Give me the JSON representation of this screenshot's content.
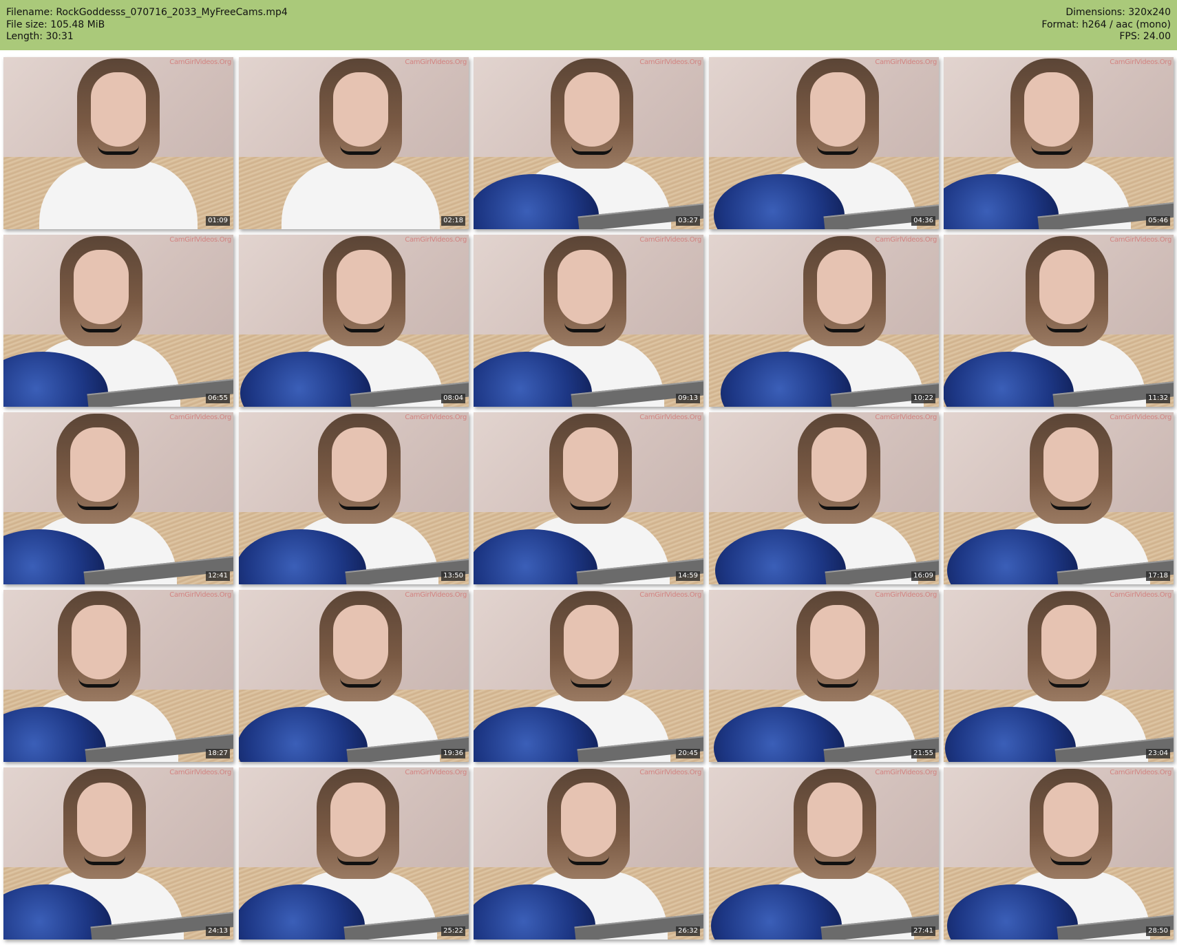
{
  "info": {
    "filename_label": "Filename:",
    "filename": "RockGoddesss_070716_2033_MyFreeCams.mp4",
    "filesize_label": "File size:",
    "filesize": "105.48 MiB",
    "length_label": "Length:",
    "length": "30:31",
    "dimensions_label": "Dimensions:",
    "dimensions": "320x240",
    "format_label": "Format:",
    "format": "h264 / aac (mono)",
    "fps_label": "FPS:",
    "fps": "24.00"
  },
  "watermark": "CamGirlVideos.Org",
  "thumbnails": [
    {
      "timestamp": "01:09",
      "guitar": false
    },
    {
      "timestamp": "02:18",
      "guitar": false
    },
    {
      "timestamp": "03:27",
      "guitar": true
    },
    {
      "timestamp": "04:36",
      "guitar": true
    },
    {
      "timestamp": "05:46",
      "guitar": true
    },
    {
      "timestamp": "06:55",
      "guitar": true
    },
    {
      "timestamp": "08:04",
      "guitar": true
    },
    {
      "timestamp": "09:13",
      "guitar": true
    },
    {
      "timestamp": "10:22",
      "guitar": true
    },
    {
      "timestamp": "11:32",
      "guitar": true
    },
    {
      "timestamp": "12:41",
      "guitar": true
    },
    {
      "timestamp": "13:50",
      "guitar": true
    },
    {
      "timestamp": "14:59",
      "guitar": true
    },
    {
      "timestamp": "16:09",
      "guitar": true
    },
    {
      "timestamp": "17:18",
      "guitar": true
    },
    {
      "timestamp": "18:27",
      "guitar": true
    },
    {
      "timestamp": "19:36",
      "guitar": true
    },
    {
      "timestamp": "20:45",
      "guitar": true
    },
    {
      "timestamp": "21:55",
      "guitar": true
    },
    {
      "timestamp": "23:04",
      "guitar": true
    },
    {
      "timestamp": "24:13",
      "guitar": true
    },
    {
      "timestamp": "25:22",
      "guitar": true
    },
    {
      "timestamp": "26:32",
      "guitar": true
    },
    {
      "timestamp": "27:41",
      "guitar": true
    },
    {
      "timestamp": "28:50",
      "guitar": true
    }
  ]
}
